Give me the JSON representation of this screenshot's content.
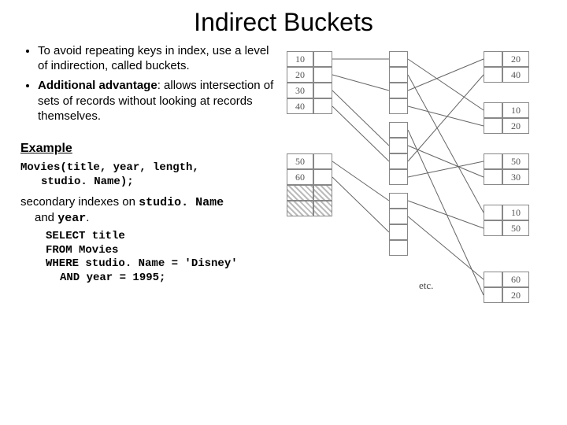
{
  "title": "Indirect Buckets",
  "bullets": [
    {
      "text": "To avoid repeating keys in index, use a level of indirection, called buckets."
    },
    {
      "bold": "Additional advantage",
      "text": ": allows intersection of sets of records without looking at records themselves."
    }
  ],
  "example_heading": "Example",
  "schema_line1": "Movies(title, year, length,",
  "schema_line2": "studio. Name);",
  "secondary_prefix": "secondary indexes on ",
  "secondary_cols": [
    "studio. Name",
    "year"
  ],
  "secondary_joiner": " and ",
  "secondary_suffix": ".",
  "sql": [
    "SELECT title",
    "FROM Movies",
    "WHERE studio. Name = 'Disney'",
    "AND year = 1995;"
  ],
  "index": {
    "group1": [
      "10",
      "20",
      "30",
      "40"
    ],
    "group2": [
      "50",
      "60"
    ]
  },
  "data_blocks": [
    [
      "20",
      "40"
    ],
    [
      "10",
      "20"
    ],
    [
      "50",
      "30"
    ],
    [
      "10",
      "50"
    ],
    [
      "60",
      "20"
    ]
  ],
  "etc_label": "etc."
}
